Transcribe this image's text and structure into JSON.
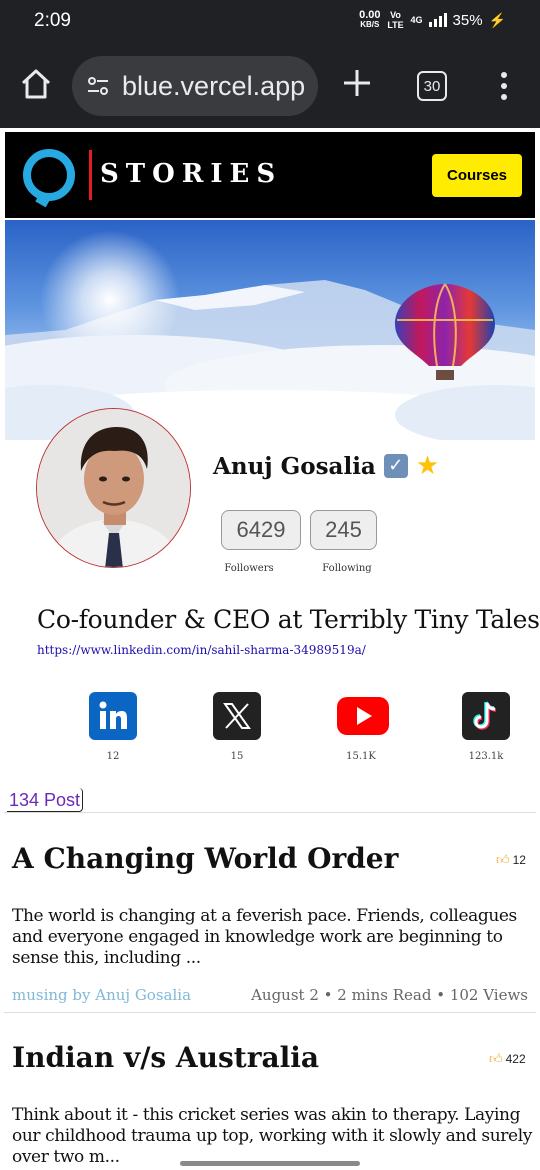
{
  "status_bar": {
    "time": "2:09",
    "net_speed": "0.00",
    "net_unit": "KB/S",
    "volte": "Vo LTE",
    "network": "4G",
    "battery": "35%"
  },
  "browser": {
    "url": "blue.vercel.app",
    "tab_count": "30"
  },
  "site": {
    "logo_text": "STORIES",
    "courses_label": "Courses"
  },
  "profile": {
    "name": "Anuj Gosalia",
    "verified_icon": "check-mark-button",
    "star_icon": "star",
    "followers_count": "6429",
    "followers_label": "Followers",
    "following_count": "245",
    "following_label": "Following",
    "bio": "Co-founder & CEO at Terribly Tiny Tales",
    "link": "https://www.linkedin.com/in/sahil-sharma-34989519a/"
  },
  "socials": [
    {
      "name": "linkedin",
      "count": "12",
      "color": "#0a66c2"
    },
    {
      "name": "x",
      "count": "15",
      "color": "#222222"
    },
    {
      "name": "youtube",
      "count": "15.1K",
      "color": "#ff0000"
    },
    {
      "name": "tiktok",
      "count": "123.1k",
      "color": "#222222"
    }
  ],
  "post_count": "134 Post",
  "posts": [
    {
      "title": "A Changing World Order",
      "likes": "12",
      "excerpt": "The world is changing at a feverish pace. Friends, colleagues and everyone engaged in knowledge work are beginning to sense this, including ...",
      "author": "musing by Anuj Gosalia",
      "meta": "August 2 • 2 mins Read • 102 Views"
    },
    {
      "title": "Indian v/s Australia",
      "likes": "422",
      "excerpt": "Think about it - this cricket series was akin to therapy. Laying our childhood trauma up top, working with it slowly and surely over two m..."
    }
  ]
}
